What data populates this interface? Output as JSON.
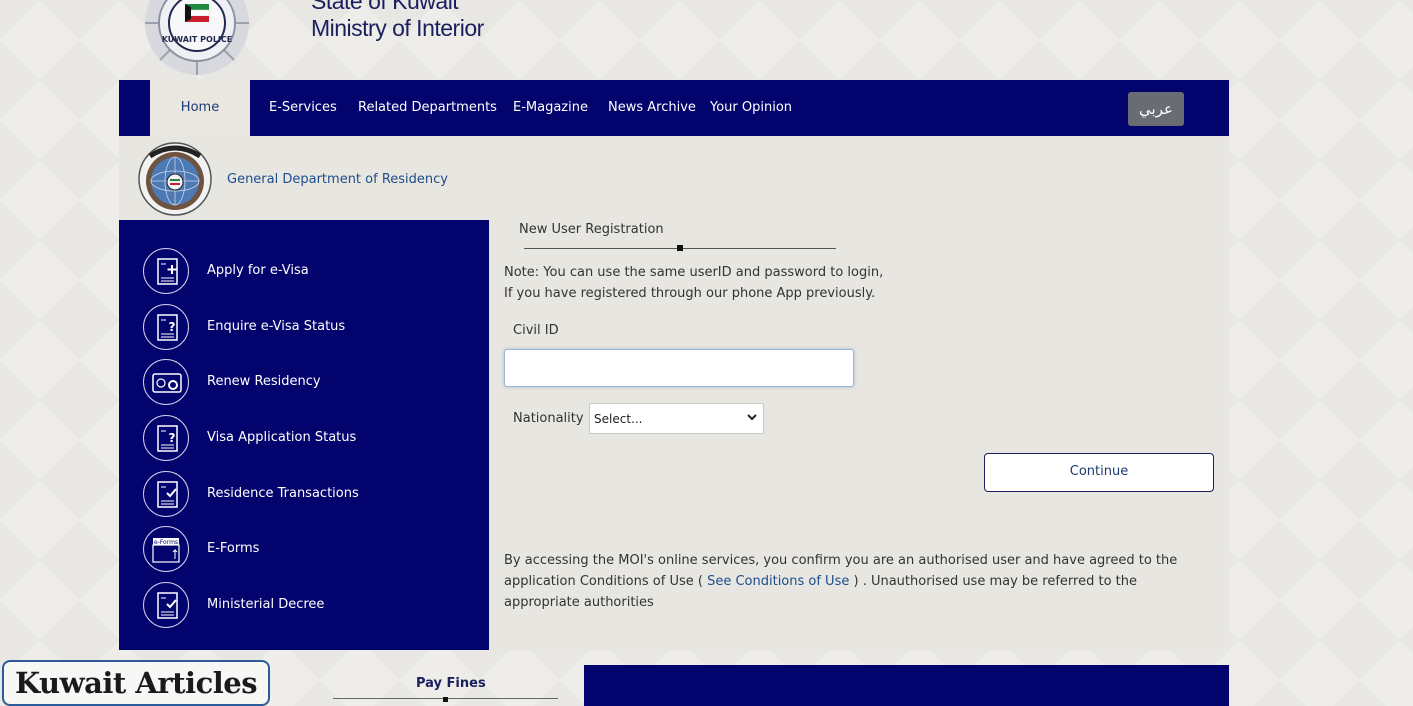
{
  "header": {
    "title_line1": "State of Kuwait",
    "title_line2": "Ministry of Interior",
    "logo_icon": "kuwait-police-emblem-icon"
  },
  "nav": {
    "items": [
      "Home",
      "E-Services",
      "Related Departments",
      "E-Magazine",
      "News Archive",
      "Your Opinion"
    ],
    "language_button": "عربي"
  },
  "department": {
    "name": "General Department of Residency",
    "logo_icon": "residency-emblem-icon"
  },
  "sidebar": {
    "items": [
      {
        "label": "Apply for e-Visa",
        "icon": "document-plus-icon"
      },
      {
        "label": "Enquire e-Visa Status",
        "icon": "document-question-icon"
      },
      {
        "label": "Renew Residency",
        "icon": "id-card-renew-icon"
      },
      {
        "label": "Visa Application Status",
        "icon": "document-question-icon"
      },
      {
        "label": "Residence Transactions",
        "icon": "document-check-icon"
      },
      {
        "label": "E-Forms",
        "icon": "e-forms-icon"
      },
      {
        "label": "Ministerial Decree",
        "icon": "document-check-icon"
      }
    ],
    "eforms_badge": "e-Forms"
  },
  "form": {
    "heading": "New User Registration",
    "note_line1": "Note: You can use the same userID and password to login,",
    "note_line2": "If you have registered through our phone App previously.",
    "civil_id_label": "Civil ID",
    "civil_id_value": "",
    "nationality_label": "Nationality",
    "nationality_selected": "Select...",
    "continue_label": "Continue"
  },
  "terms": {
    "text1": "By accessing the MOI's online services, you confirm you are an authorised user and have agreed to the application Conditions of Use ( ",
    "link": "See Conditions of Use",
    "text2": " ) . Unauthorised use may be referred to the appropriate authorities"
  },
  "footer": {
    "watermark": "Kuwait Articles",
    "pay_fines": "Pay Fines"
  },
  "colors": {
    "navy": "#03036e",
    "panel": "#e8e6e0",
    "link": "#1d4d8c"
  }
}
